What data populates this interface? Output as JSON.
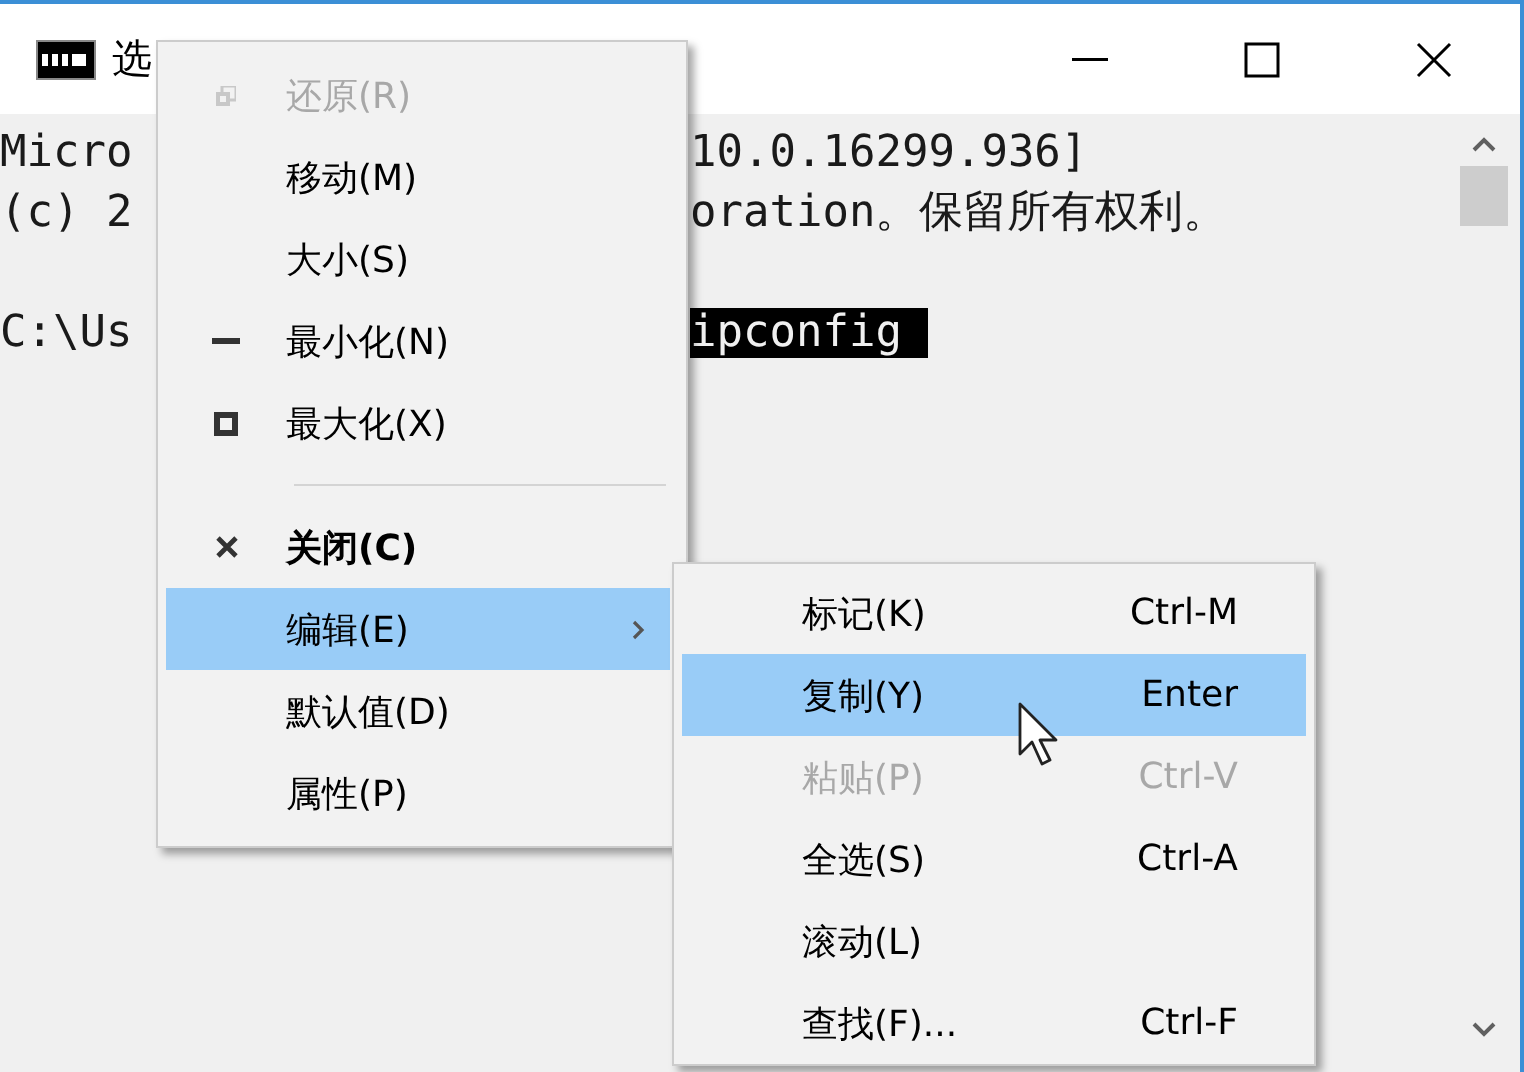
{
  "window": {
    "title": "选"
  },
  "console": {
    "lines": [
      {
        "left": "Micro",
        "right": "10.0.16299.936]",
        "right_selected": false
      },
      {
        "left": "(c) 2",
        "right": "oration。保留所有权利。",
        "right_selected": false
      },
      {
        "left": "C:\\Us",
        "right": "ipconfig ",
        "right_selected": true
      }
    ]
  },
  "menu": {
    "items": [
      {
        "kind": "restore",
        "label": "还原(R)",
        "disabled": true,
        "bold": false,
        "selected": false,
        "submenu": false
      },
      {
        "kind": "plain",
        "label": "移动(M)",
        "disabled": false,
        "bold": false,
        "selected": false,
        "submenu": false
      },
      {
        "kind": "plain",
        "label": "大小(S)",
        "disabled": false,
        "bold": false,
        "selected": false,
        "submenu": false
      },
      {
        "kind": "minimize",
        "label": "最小化(N)",
        "disabled": false,
        "bold": false,
        "selected": false,
        "submenu": false
      },
      {
        "kind": "maximize",
        "label": "最大化(X)",
        "disabled": false,
        "bold": false,
        "selected": false,
        "submenu": false
      },
      {
        "kind": "separator"
      },
      {
        "kind": "close",
        "label": "关闭(C)",
        "disabled": false,
        "bold": true,
        "selected": false,
        "submenu": false
      },
      {
        "kind": "plain",
        "label": "编辑(E)",
        "disabled": false,
        "bold": false,
        "selected": true,
        "submenu": true
      },
      {
        "kind": "plain",
        "label": "默认值(D)",
        "disabled": false,
        "bold": false,
        "selected": false,
        "submenu": false
      },
      {
        "kind": "plain",
        "label": "属性(P)",
        "disabled": false,
        "bold": false,
        "selected": false,
        "submenu": false
      }
    ]
  },
  "submenu": {
    "items": [
      {
        "label": "标记(K)",
        "shortcut": "Ctrl-M",
        "disabled": false,
        "selected": false
      },
      {
        "label": "复制(Y)",
        "shortcut": "Enter",
        "disabled": false,
        "selected": true
      },
      {
        "label": "粘贴(P)",
        "shortcut": "Ctrl-V",
        "disabled": true,
        "selected": false
      },
      {
        "label": "全选(S)",
        "shortcut": "Ctrl-A",
        "disabled": false,
        "selected": false
      },
      {
        "label": "滚动(L)",
        "disabled": false,
        "selected": false
      },
      {
        "label": "查找(F)...",
        "shortcut": "Ctrl-F",
        "disabled": false,
        "selected": false
      }
    ]
  }
}
